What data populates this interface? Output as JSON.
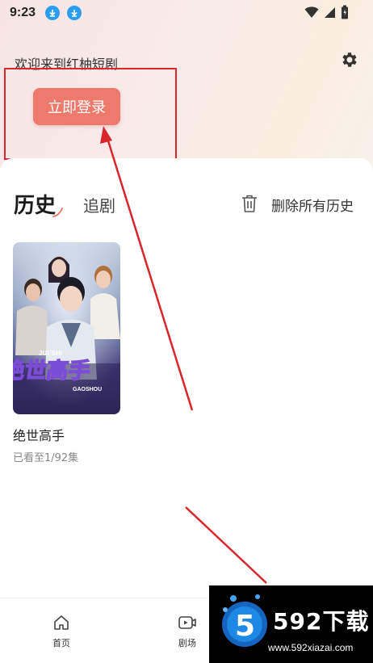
{
  "status_bar": {
    "time": "9:23"
  },
  "header": {
    "welcome_text": "欢迎来到红柚短剧",
    "login_button": "立即登录"
  },
  "tabs": {
    "history": "历史",
    "following": "追剧",
    "delete_all": "删除所有历史"
  },
  "history_items": [
    {
      "title": "绝世高手",
      "progress": "已看至1/92集",
      "poster_text": "绝世高手",
      "poster_sub_top": "JUESHI",
      "poster_sub_bottom": "GAOSHOU"
    }
  ],
  "bottom_nav": {
    "home": "首页",
    "theater": "剧场"
  },
  "watermark": {
    "logo_digit": "5",
    "logo_text": "592下载",
    "url": "www.592xiazai.com"
  },
  "colors": {
    "login_button": "#ed7a6d",
    "annotation": "#d9252c",
    "download_badge": "#2a9df4"
  },
  "icons": [
    "download-icon",
    "wifi-icon",
    "signal-icon",
    "battery-icon",
    "gear-icon",
    "trash-icon",
    "home-icon",
    "video-icon"
  ]
}
